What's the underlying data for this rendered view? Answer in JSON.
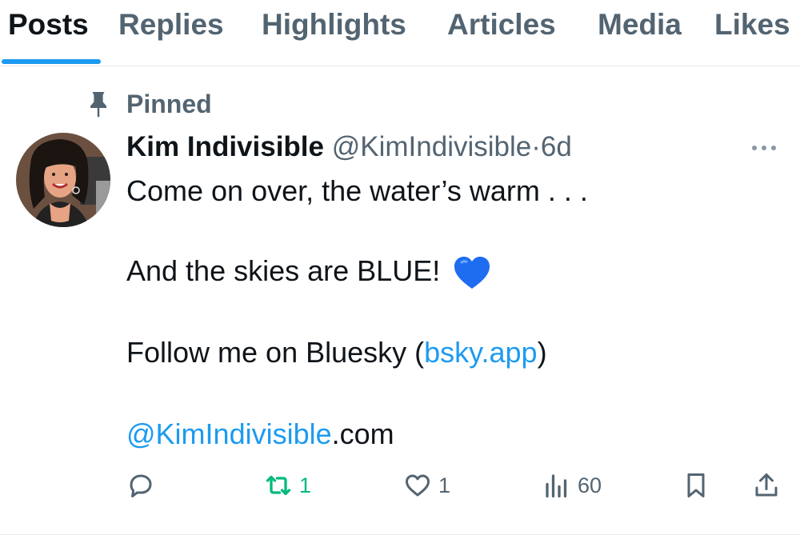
{
  "tabs": {
    "posts": "Posts",
    "replies": "Replies",
    "highlights": "Highlights",
    "articles": "Articles",
    "media": "Media",
    "likes": "Likes",
    "active": "Posts"
  },
  "post": {
    "pinned_label": "Pinned",
    "author_name": "Kim Indivisible",
    "handle": "@KimIndivisible",
    "separator": "·",
    "time": "6d",
    "lines": {
      "line1": "Come on over, the water’s warm . . .",
      "line2": "And the skies are BLUE!",
      "line3_prefix": "Follow me on Bluesky (",
      "line3_link": "bsky.app",
      "line3_suffix": ")",
      "line4_link": "@KimIndivisible",
      "line4_suffix": ".com"
    },
    "emoji": "blue-heart-icon",
    "actions": {
      "replies": "",
      "reposts": "1",
      "likes": "1",
      "views": "60"
    }
  },
  "colors": {
    "accent": "#1d9bf0",
    "secondary_text": "#536471",
    "repost_green": "#00ba7c",
    "heart_blue": "#1e6cf0"
  }
}
